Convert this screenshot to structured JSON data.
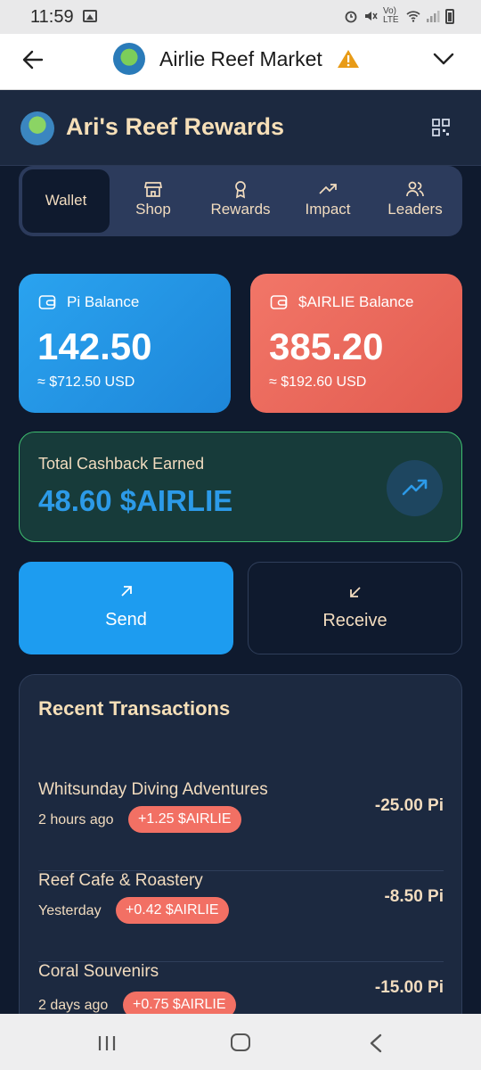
{
  "status_bar": {
    "time": "11:59",
    "network": "Vo) LTE"
  },
  "browser": {
    "site_title": "Airlie Reef Market"
  },
  "app": {
    "title": "Ari's Reef Rewards"
  },
  "nav": {
    "tabs": [
      {
        "label": "Wallet",
        "icon": "wallet",
        "active": true
      },
      {
        "label": "Shop",
        "icon": "store-icon"
      },
      {
        "label": "Rewards",
        "icon": "award-icon"
      },
      {
        "label": "Impact",
        "icon": "trending-up-icon"
      },
      {
        "label": "Leaders",
        "icon": "users-icon"
      }
    ]
  },
  "balances": {
    "pi": {
      "label": "Pi Balance",
      "amount": "142.50",
      "usd": "≈ $712.50 USD",
      "color": "#2aa3ef"
    },
    "airlie": {
      "label": "$AIRLIE Balance",
      "amount": "385.20",
      "usd": "≈ $192.60 USD",
      "color": "#f27668"
    }
  },
  "cashback": {
    "label": "Total Cashback Earned",
    "value": "48.60 $AIRLIE"
  },
  "actions": {
    "send": "Send",
    "receive": "Receive"
  },
  "transactions": {
    "title": "Recent Transactions",
    "items": [
      {
        "merchant": "Whitsunday Diving Adventures",
        "when": "2 hours ago",
        "cashback": "+1.25 $AIRLIE",
        "amount": "-25.00 Pi"
      },
      {
        "merchant": "Reef Cafe & Roastery",
        "when": "Yesterday",
        "cashback": "+0.42 $AIRLIE",
        "amount": "-8.50 Pi"
      },
      {
        "merchant": "Coral Souvenirs",
        "when": "2 days ago",
        "cashback": "+0.75 $AIRLIE",
        "amount": "-15.00 Pi"
      }
    ]
  }
}
